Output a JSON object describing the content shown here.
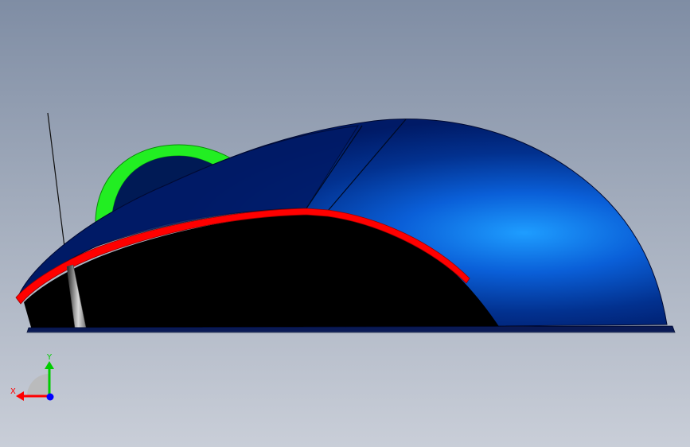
{
  "viewport": {
    "background_top": "#7f8da4",
    "background_bottom": "#c9ced8"
  },
  "model": {
    "body_color": "#001a66",
    "highlight_color": "#1e90ff",
    "underside_color": "#000000",
    "seam_color": "#ff0000",
    "wheel_color": "#22ee22"
  },
  "triad": {
    "x_label": "X",
    "y_label": "Y",
    "x_color": "#ff0000",
    "y_color": "#00cc00",
    "z_color": "#0000ff",
    "icon": "axis-triad-icon"
  }
}
